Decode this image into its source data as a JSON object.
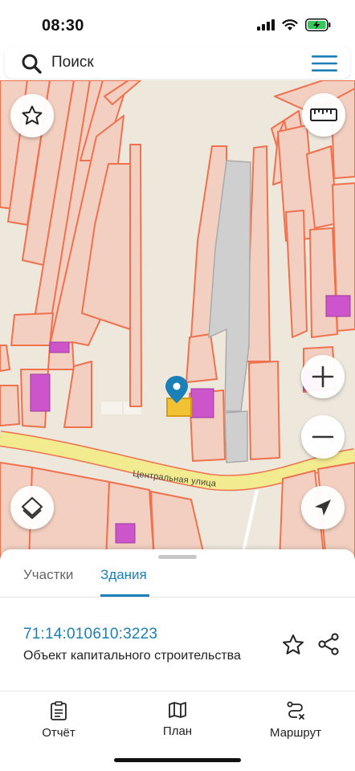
{
  "status_bar": {
    "time": "08:30"
  },
  "search": {
    "placeholder": "Поиск"
  },
  "map": {
    "street_label": "Центральная улица"
  },
  "sheet": {
    "tabs": [
      {
        "label": "Участки",
        "active": false
      },
      {
        "label": "Здания",
        "active": true
      }
    ],
    "result": {
      "cadastral_number": "71:14:010610:3223",
      "description": "Объект капитального строительства"
    }
  },
  "bottom_nav": {
    "items": [
      {
        "label": "Отчёт",
        "icon": "report-icon"
      },
      {
        "label": "План",
        "icon": "map-plan-icon"
      },
      {
        "label": "Маршрут",
        "icon": "route-icon"
      }
    ]
  },
  "colors": {
    "accent": "#1b7fb8",
    "parcel_border": "#f0714e",
    "parcel_fill": "#f2cfc0",
    "building_fill": "#cc55cc",
    "road": "#f3eb90",
    "map_background": "#ede7dc"
  }
}
